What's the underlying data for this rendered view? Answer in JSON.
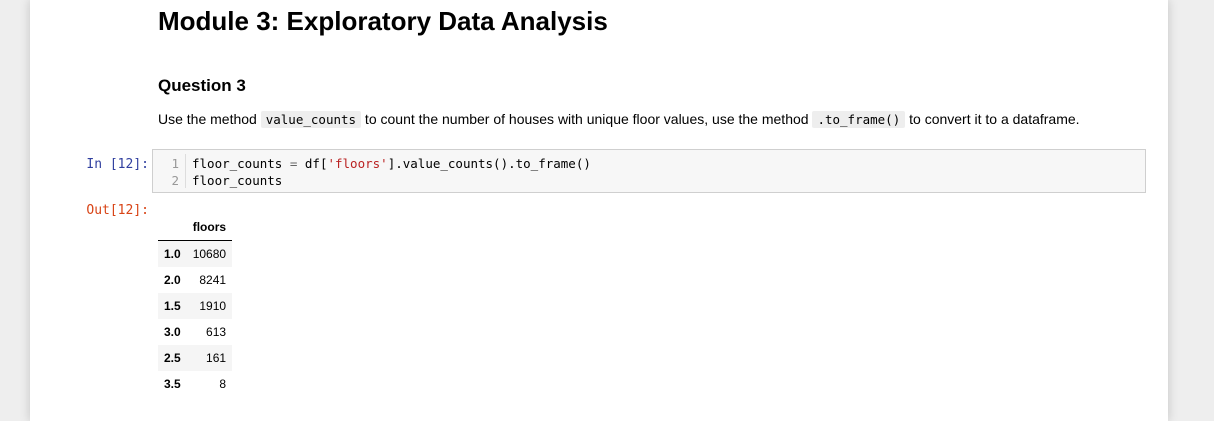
{
  "heading": "Module 3: Exploratory Data Analysis",
  "question_title": "Question 3",
  "instruction": {
    "part1": "Use the method ",
    "code1": "value_counts",
    "part2": " to count the number of houses with unique floor values, use the method ",
    "code2": ".to_frame()",
    "part3": " to convert it to a dataframe."
  },
  "input_prompt": "In [12]:",
  "output_prompt": "Out[12]:",
  "code_lines": [
    {
      "num": "1",
      "var": "floor_counts",
      "op": " = ",
      "pre": "df[",
      "str": "'floors'",
      "post": "].value_counts().to_frame()"
    },
    {
      "num": "2",
      "text": "floor_counts"
    }
  ],
  "table": {
    "column": "floors",
    "rows": [
      {
        "index": "1.0",
        "value": "10680"
      },
      {
        "index": "2.0",
        "value": "8241"
      },
      {
        "index": "1.5",
        "value": "1910"
      },
      {
        "index": "3.0",
        "value": "613"
      },
      {
        "index": "2.5",
        "value": "161"
      },
      {
        "index": "3.5",
        "value": "8"
      }
    ]
  }
}
